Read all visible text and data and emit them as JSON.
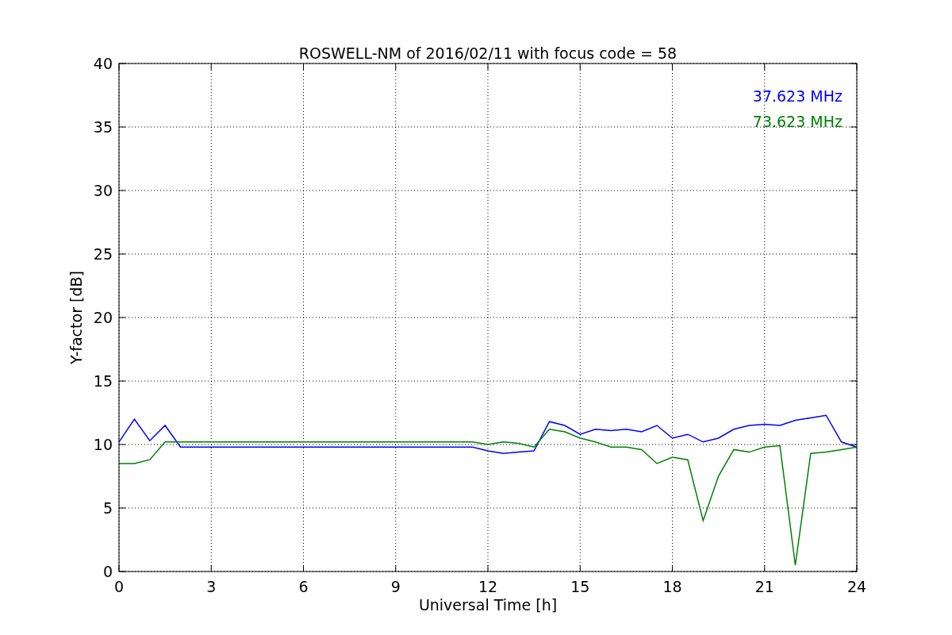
{
  "chart_data": {
    "type": "line",
    "title": "ROSWELL-NM of 2016/02/11 with focus code = 58",
    "xlabel": "Universal Time [h]",
    "ylabel": "Y-factor [dB]",
    "x": [
      0,
      0.5,
      1,
      1.5,
      2,
      2.5,
      3,
      3.5,
      4,
      4.5,
      5,
      5.5,
      6,
      6.5,
      7,
      7.5,
      8,
      8.5,
      9,
      9.5,
      10,
      10.5,
      11,
      11.5,
      12,
      12.5,
      13,
      13.5,
      14,
      14.5,
      15,
      15.5,
      16,
      16.5,
      17,
      17.5,
      18,
      18.5,
      19,
      19.5,
      20,
      20.5,
      21,
      21.5,
      22,
      22.5,
      23,
      23.5,
      24
    ],
    "series": [
      {
        "name": "37.623 MHz",
        "color": "#0000ff",
        "values": [
          10.2,
          12,
          10.3,
          11.5,
          9.8,
          9.8,
          9.8,
          9.8,
          9.8,
          9.8,
          9.8,
          9.8,
          9.8,
          9.8,
          9.8,
          9.8,
          9.8,
          9.8,
          9.8,
          9.8,
          9.8,
          9.8,
          9.8,
          9.8,
          9.5,
          9.3,
          9.4,
          9.5,
          11.8,
          11.5,
          10.8,
          11.2,
          11.1,
          11.2,
          11.0,
          11.5,
          10.5,
          10.8,
          10.2,
          10.5,
          11.2,
          11.5,
          11.6,
          11.5,
          11.9,
          12.1,
          12.3,
          10.2,
          9.8
        ]
      },
      {
        "name": "73.623 MHz",
        "color": "#008000",
        "values": [
          8.5,
          8.5,
          8.8,
          10.2,
          10.2,
          10.2,
          10.2,
          10.2,
          10.2,
          10.2,
          10.2,
          10.2,
          10.2,
          10.2,
          10.2,
          10.2,
          10.2,
          10.2,
          10.2,
          10.2,
          10.2,
          10.2,
          10.2,
          10.2,
          10,
          10.2,
          10.1,
          9.8,
          11.2,
          11,
          10.5,
          10.2,
          9.8,
          9.8,
          9.6,
          8.5,
          9,
          8.8,
          4,
          7.5,
          9.6,
          9.4,
          9.8,
          9.9,
          0.5,
          9.3,
          9.4,
          9.6,
          9.8
        ]
      }
    ],
    "grid": true,
    "xlim": [
      0,
      24
    ],
    "ylim": [
      0,
      40
    ],
    "xticks": [
      0,
      3,
      6,
      9,
      12,
      15,
      18,
      21,
      24
    ],
    "yticks": [
      0,
      5,
      10,
      15,
      20,
      25,
      30,
      35,
      40
    ]
  }
}
